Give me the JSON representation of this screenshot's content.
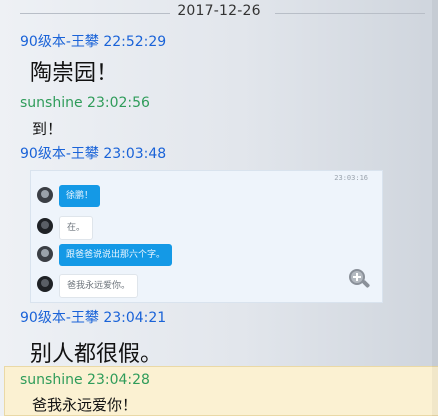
{
  "date_divider": "2017-12-26",
  "messages": [
    {
      "sender": "90级本-王攀",
      "time": "22:52:29",
      "meta": "90级本-王攀 22:52:29",
      "text": "陶崇园！"
    },
    {
      "sender": "sunshine",
      "time": "23:02:56",
      "meta": "sunshine 23:02:56",
      "text": "到！"
    },
    {
      "sender": "90级本-王攀",
      "time": "23:03:48",
      "meta": "90级本-王攀 23:03:48",
      "image": {
        "timestamp": "23:03:16",
        "bubbles": [
          {
            "text": "徐鹏！",
            "style": "blue"
          },
          {
            "text": "在。",
            "style": "white"
          },
          {
            "text": "跟爸爸说说出那六个字。",
            "style": "blue"
          },
          {
            "text": "爸我永远爱你。",
            "style": "white"
          }
        ],
        "zoom_icon": "zoom-in-icon"
      }
    },
    {
      "sender": "90级本-王攀",
      "time": "23:04:21",
      "meta": "90级本-王攀 23:04:21",
      "text": "别人都很假。"
    },
    {
      "sender": "sunshine",
      "time": "23:04:28",
      "meta": "sunshine 23:04:28",
      "text": "爸我永远爱你！",
      "highlighted": true
    }
  ],
  "colors": {
    "sender_blue": "#1a63d8",
    "sender_green": "#2f9c5a",
    "highlight_bg": "#fbf1d2",
    "bubble_blue": "#1499e6"
  }
}
